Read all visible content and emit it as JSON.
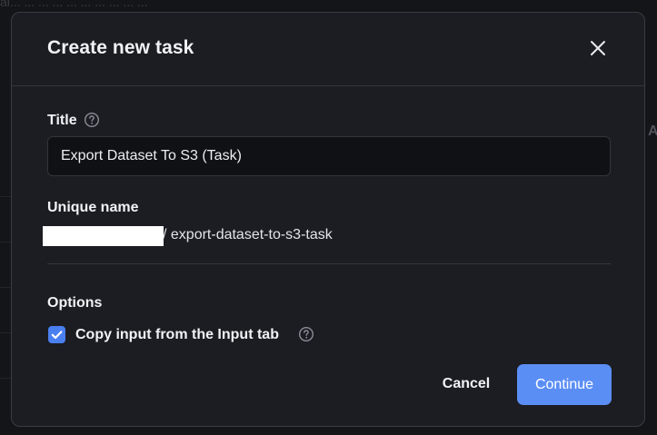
{
  "background": {
    "top_text": "ai...     ...  ...   ...     ...   ...           ...   ...  ...   ...",
    "side_letter": "A"
  },
  "modal": {
    "title": "Create new task",
    "close_icon": "close-icon",
    "title_field": {
      "label": "Title",
      "value": "Export Dataset To S3 (Task)",
      "help_icon": "question-circle-icon"
    },
    "unique_name": {
      "label": "Unique name",
      "value": "/ export-dataset-to-s3-task"
    },
    "options": {
      "label": "Options",
      "copy_input": {
        "checked": true,
        "label": "Copy input from the Input tab",
        "help_icon": "question-circle-icon"
      }
    },
    "buttons": {
      "cancel": "Cancel",
      "continue": "Continue"
    }
  },
  "colors": {
    "accent": "#5b8ef5",
    "checkbox": "#4a7ff0",
    "modal_bg": "#1c1d22",
    "input_bg": "#101114"
  }
}
